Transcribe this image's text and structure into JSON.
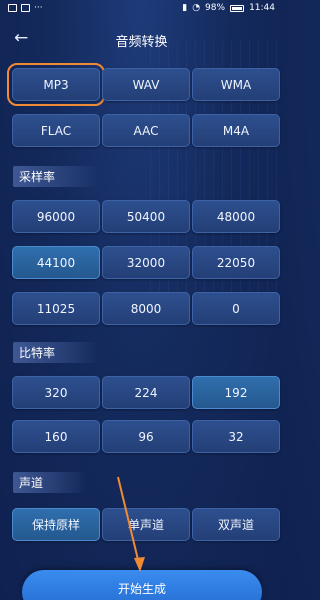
{
  "status_bar": {
    "battery_percent": "98%",
    "time": "11:44"
  },
  "header": {
    "title": "音频转换",
    "back_icon": "arrow-left-icon"
  },
  "formats": {
    "items": [
      "MP3",
      "WAV",
      "WMA",
      "FLAC",
      "AAC",
      "M4A"
    ],
    "selected": "MP3"
  },
  "sample_rate": {
    "label": "采样率",
    "items": [
      "96000",
      "50400",
      "48000",
      "44100",
      "32000",
      "22050",
      "11025",
      "8000",
      "0"
    ],
    "selected": "44100"
  },
  "bit_rate": {
    "label": "比特率",
    "items": [
      "320",
      "224",
      "192",
      "160",
      "96",
      "32"
    ],
    "selected": "192"
  },
  "channel": {
    "label": "声道",
    "items": [
      "保持原样",
      "单声道",
      "双声道"
    ],
    "selected": "保持原样"
  },
  "actions": {
    "start_label": "开始生成"
  },
  "colors": {
    "highlight_outline": "#f08a35",
    "button_bg": "#2d4f8e",
    "selected_bg": "#2f6fae",
    "start_button": "#2f7ce6"
  }
}
